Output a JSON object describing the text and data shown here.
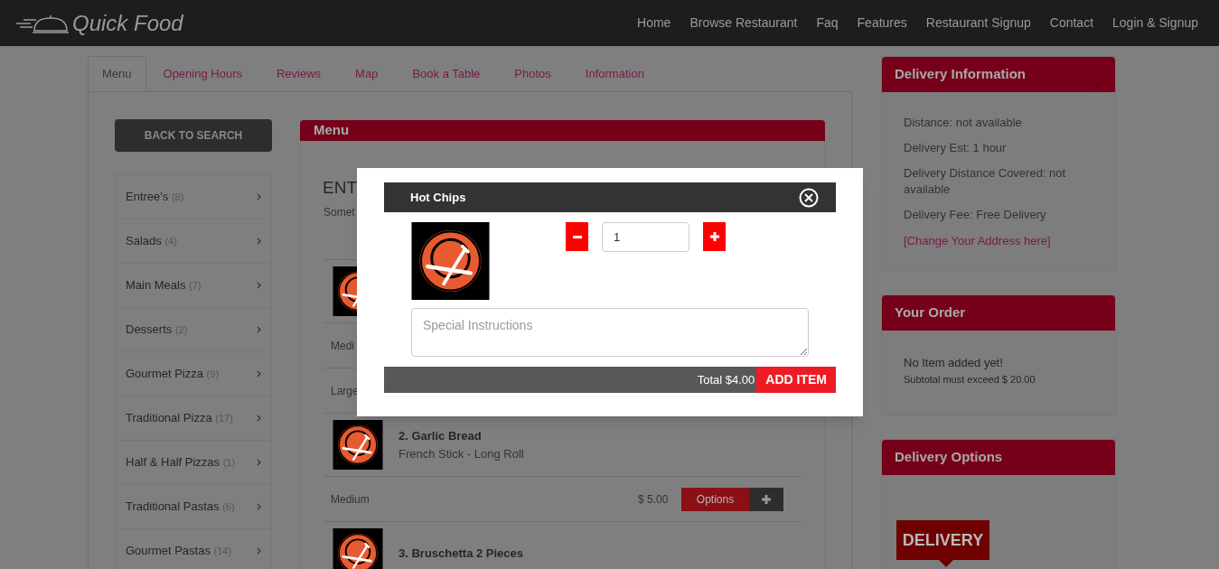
{
  "header": {
    "logo": "Quick Food",
    "nav": [
      "Home",
      "Browse Restaurant",
      "Faq",
      "Features",
      "Restaurant Signup",
      "Contact",
      "Login & Signup"
    ]
  },
  "tabs": [
    {
      "label": "Menu",
      "selected": true
    },
    {
      "label": "Opening Hours",
      "selected": false
    },
    {
      "label": "Reviews",
      "selected": false
    },
    {
      "label": "Map",
      "selected": false
    },
    {
      "label": "Book a Table",
      "selected": false
    },
    {
      "label": "Photos",
      "selected": false
    },
    {
      "label": "Information",
      "selected": false
    }
  ],
  "back_button": "BACK TO SEARCH",
  "categories": [
    {
      "name": "Entree's",
      "count": "(8)"
    },
    {
      "name": "Salads",
      "count": "(4)"
    },
    {
      "name": "Main Meals",
      "count": "(7)"
    },
    {
      "name": "Desserts",
      "count": "(2)"
    },
    {
      "name": "Gourmet Pizza",
      "count": "(9)"
    },
    {
      "name": "Traditional Pizza",
      "count": "(17)"
    },
    {
      "name": "Half & Half Pizzas",
      "count": "(1)"
    },
    {
      "name": "Traditional Pastas",
      "count": "(6)"
    },
    {
      "name": "Gourmet Pastas",
      "count": "(14)"
    }
  ],
  "menu": {
    "title": "Menu",
    "section_title": "ENT",
    "section_note": "Somet",
    "items": [
      {
        "sizes": [
          {
            "label": "Medi"
          },
          {
            "label": "Large"
          }
        ]
      },
      {
        "name": "2. Garlic Bread",
        "description": "French Stick - Long Roll",
        "sizes": [
          {
            "label": "Medium",
            "price": "$ 5.00",
            "button": "Options"
          }
        ]
      },
      {
        "name": "3. Bruschetta 2 Pieces"
      }
    ]
  },
  "delivery_info": {
    "title": "Delivery Information",
    "lines": [
      "Distance: not available",
      "Delivery Est: 1 hour",
      "Delivery Distance Covered: not available",
      "Delivery Fee: Free Delivery"
    ],
    "link": "[Change Your Address here]"
  },
  "your_order": {
    "title": "Your Order",
    "message": "No Item added yet!",
    "note": "Subtotal must exceed $ 20.00"
  },
  "delivery_options": {
    "title": "Delivery Options",
    "badge": "DELIVERY"
  },
  "modal": {
    "title": "Hot Chips",
    "quantity": "1",
    "instructions_placeholder": "Special Instructions",
    "total": "Total $4.00",
    "add_button": "ADD ITEM"
  }
}
